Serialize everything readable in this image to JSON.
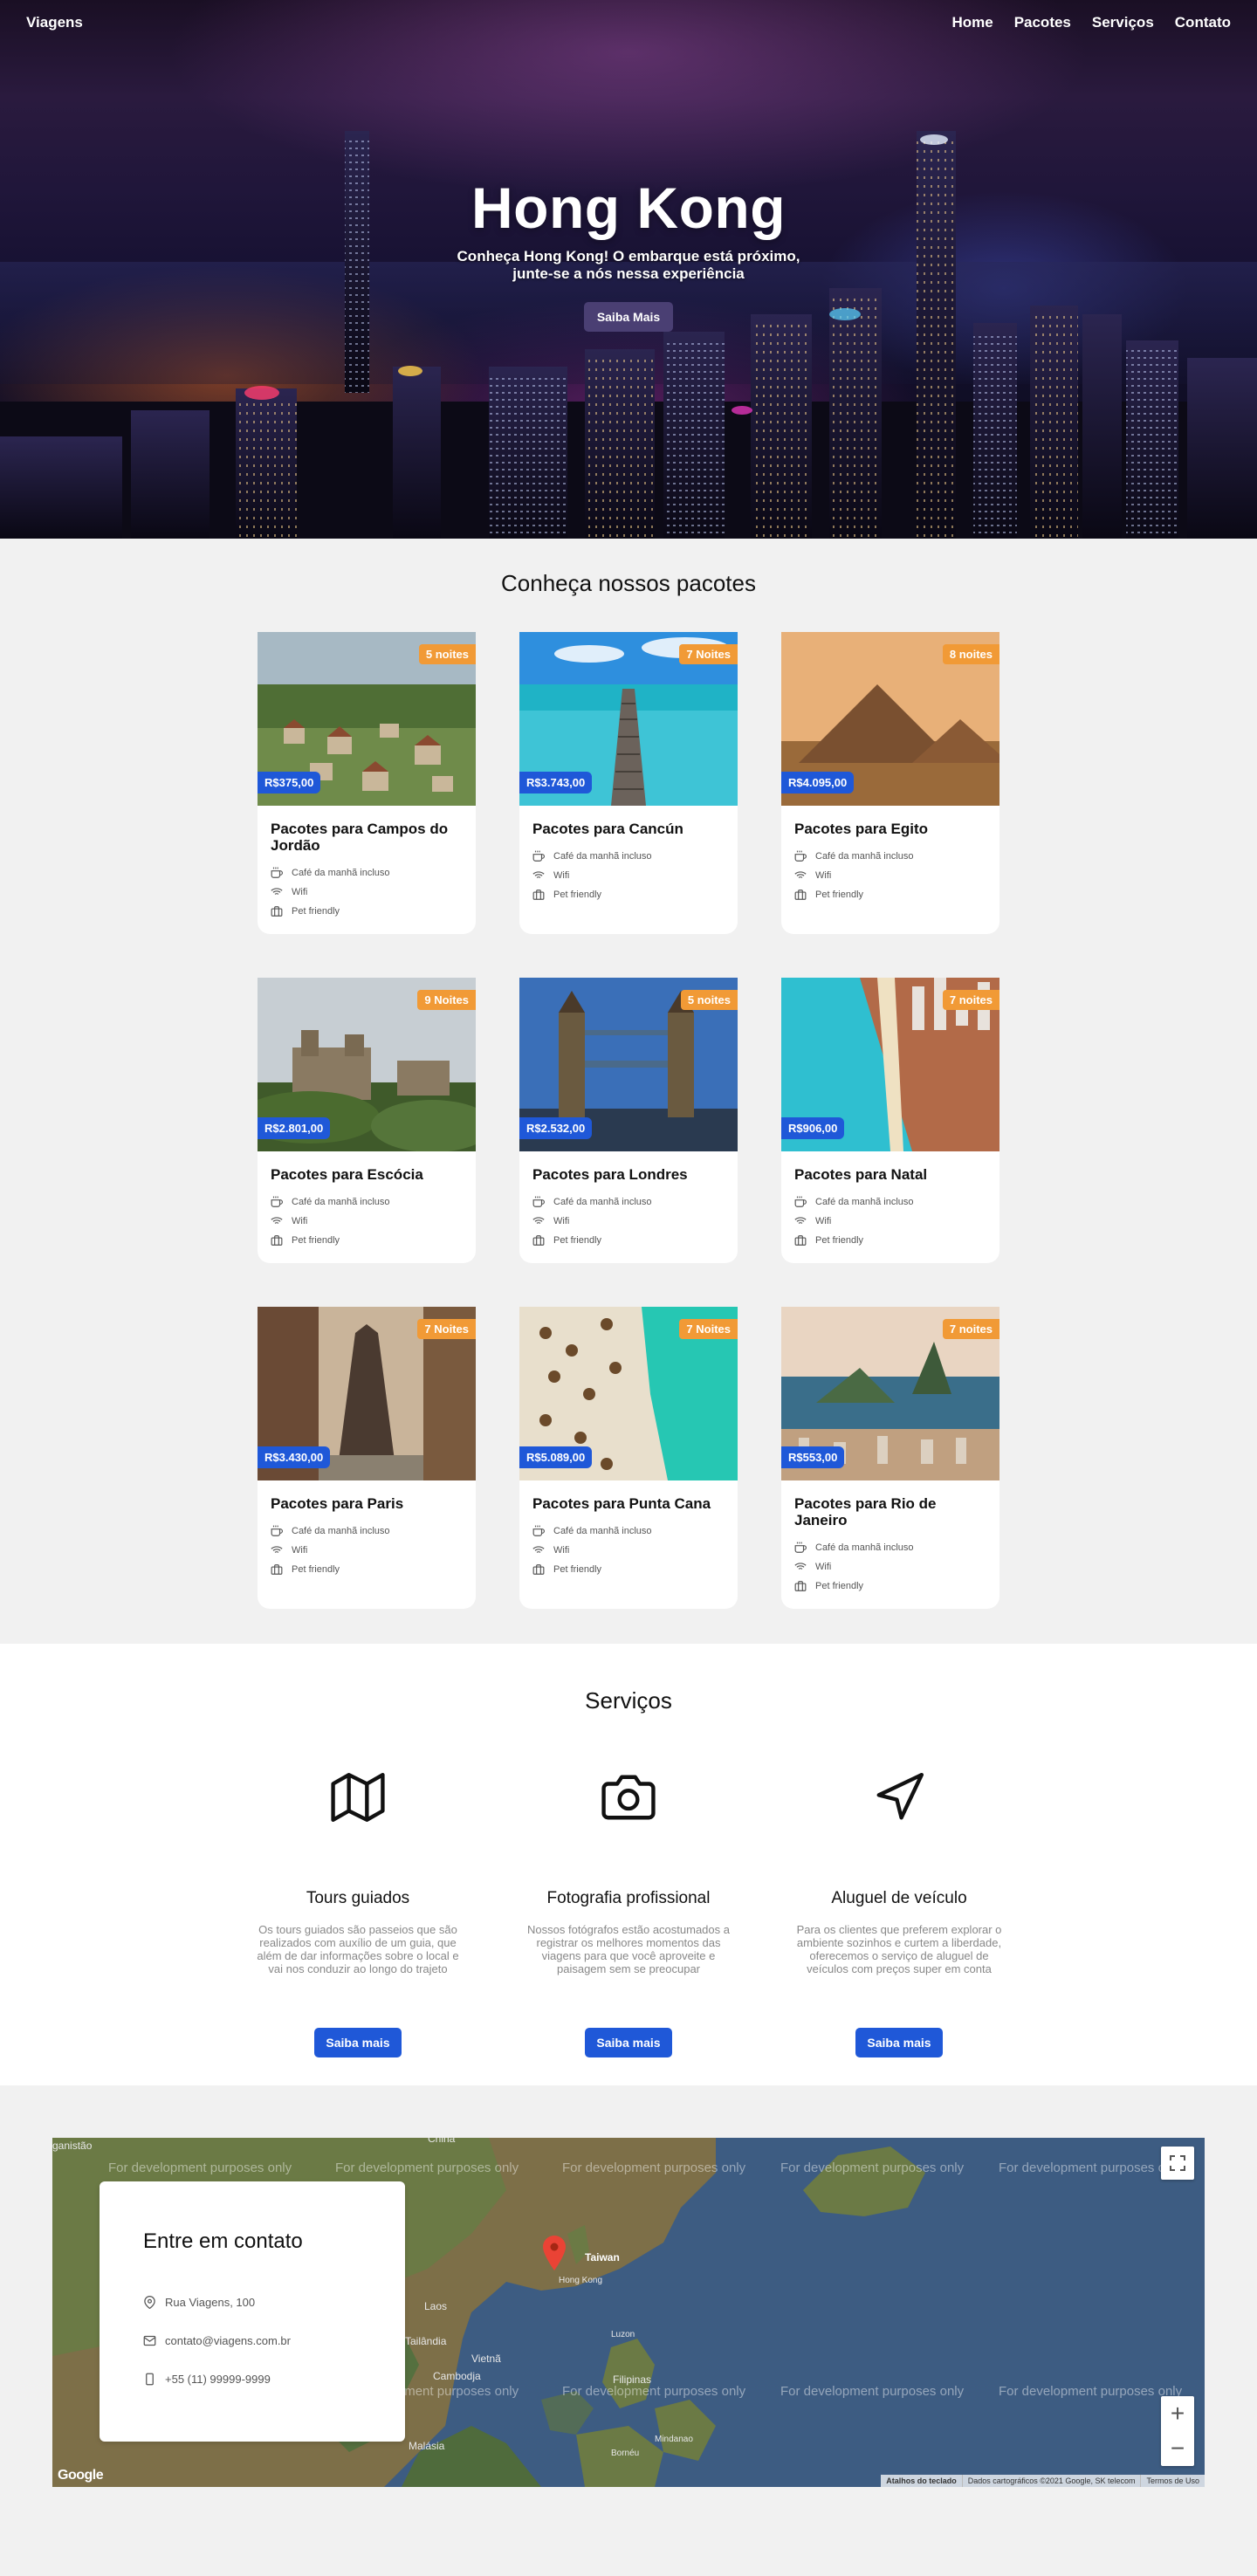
{
  "nav": {
    "brand": "Viagens",
    "links": [
      "Home",
      "Pacotes",
      "Serviços",
      "Contato"
    ]
  },
  "hero": {
    "title": "Hong Kong",
    "subtitle": "Conheça Hong Kong! O embarque está próximo, junte-se a nós nessa experiência",
    "button": "Saiba Mais"
  },
  "packages": {
    "title": "Conheça nossos pacotes",
    "feature_labels": [
      "Café da manhã incluso",
      "Wifi",
      "Pet friendly"
    ],
    "items": [
      {
        "title": "Pacotes para Campos do Jordão",
        "nights": "5 noites",
        "price": "R$375,00",
        "scene": "campos"
      },
      {
        "title": "Pacotes para Cancún",
        "nights": "7 Noites",
        "price": "R$3.743,00",
        "scene": "cancun"
      },
      {
        "title": "Pacotes para Egito",
        "nights": "8 noites",
        "price": "R$4.095,00",
        "scene": "egito"
      },
      {
        "title": "Pacotes para Escócia",
        "nights": "9 Noites",
        "price": "R$2.801,00",
        "scene": "escocia"
      },
      {
        "title": "Pacotes para Londres",
        "nights": "5 noites",
        "price": "R$2.532,00",
        "scene": "londres"
      },
      {
        "title": "Pacotes para Natal",
        "nights": "7 noites",
        "price": "R$906,00",
        "scene": "natal"
      },
      {
        "title": "Pacotes para Paris",
        "nights": "7 Noites",
        "price": "R$3.430,00",
        "scene": "paris"
      },
      {
        "title": "Pacotes para Punta Cana",
        "nights": "7 Noites",
        "price": "R$5.089,00",
        "scene": "punta"
      },
      {
        "title": "Pacotes para Rio de Janeiro",
        "nights": "7 noites",
        "price": "R$553,00",
        "scene": "rio"
      }
    ]
  },
  "services": {
    "title": "Serviços",
    "items": [
      {
        "icon": "map-icon",
        "title": "Tours guiados",
        "text": "Os tours guiados são passeios que são realizados com auxílio de um guia, que além de dar informações sobre o local e vai nos conduzir ao longo do trajeto",
        "button": "Saiba mais"
      },
      {
        "icon": "camera-icon",
        "title": "Fotografia profissional",
        "text": "Nossos fotógrafos estão acostumados a registrar os melhores momentos das viagens para que você aproveite e paisagem sem se preocupar",
        "button": "Saiba mais"
      },
      {
        "icon": "navigation-icon",
        "title": "Aluguel de veículo",
        "text": "Para os clientes que preferem explorar o ambiente sozinhos e curtem a liberdade, oferecemos o serviço de aluguel de veículos com preços super em conta",
        "button": "Saiba mais"
      }
    ]
  },
  "contact": {
    "title": "Entre em contato",
    "address": "Rua Viagens, 100",
    "email": "contato@viagens.com.br",
    "phone": "+55 (11) 99999-9999"
  },
  "map": {
    "dev_text": "For development purposes only",
    "labels": {
      "china": "China",
      "taiwan": "Taiwan",
      "hongkong": "Hong Kong",
      "laos": "Laos",
      "tailandia": "Tailândia",
      "vietna": "Vietnã",
      "cambodja": "Cambodja",
      "filipinas": "Filipinas",
      "malasia": "Malásia",
      "afeganistao": "ganistão",
      "luzon": "Luzon",
      "mindanao": "Mindanao",
      "borneo": "Bornéu"
    },
    "footer": [
      "Atalhos do teclado",
      "Dados cartográficos ©2021 Google, SK telecom",
      "Termos de Uso"
    ],
    "logo": "Google",
    "zoom_in": "+",
    "zoom_out": "−"
  },
  "colors": {
    "accent_blue": "#1f58d8",
    "nights_orange": "#f19a36",
    "hero_button": "#4a3f73"
  }
}
